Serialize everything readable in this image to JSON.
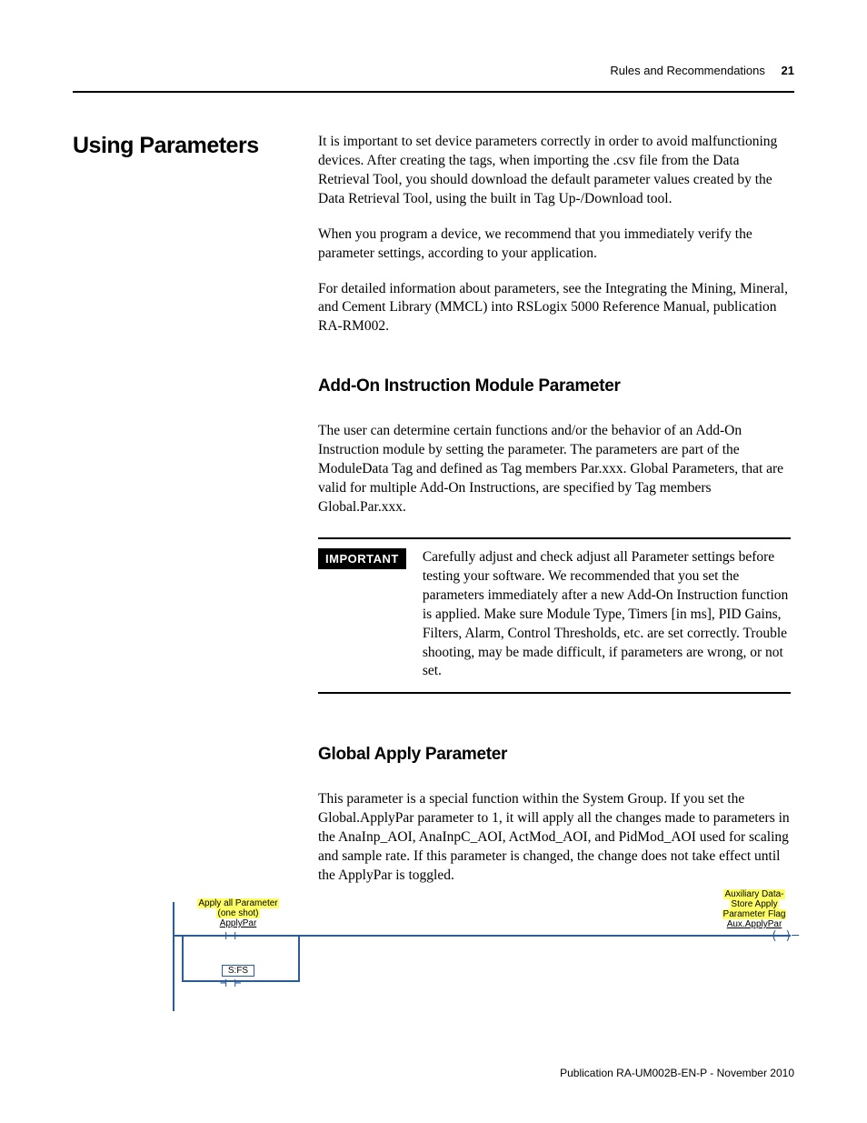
{
  "header": {
    "section": "Rules and Recommendations",
    "page_number": "21"
  },
  "main": {
    "title": "Using Parameters",
    "paragraphs": {
      "p1": "It is important to set device parameters correctly in order to avoid malfunctioning devices. After creating the tags, when importing the .csv file from the Data Retrieval Tool, you should download the default parameter values created by the Data Retrieval Tool, using the built in Tag Up-/Download tool.",
      "p2": "When you program a device, we recommend that you immediately verify the parameter settings, according to your application.",
      "p3": "For detailed information about parameters, see the Integrating the Mining, Mineral, and Cement Library (MMCL) into RSLogix 5000 Reference Manual, publication RA-RM002."
    },
    "sub1": {
      "heading": "Add-On Instruction Module Parameter",
      "p1": "The user can determine certain functions and/or the behavior of an Add-On Instruction module by setting the parameter. The parameters are part of the ModuleData Tag and defined as Tag members Par.xxx. Global Parameters, that are valid for multiple Add-On Instructions, are specified by Tag members Global.Par.xxx."
    },
    "callout": {
      "label": "IMPORTANT",
      "body": "Carefully adjust and check adjust all Parameter settings before testing your software. We recommended that you set the parameters immediately after a new Add-On Instruction function is applied. Make sure Module Type, Timers [in ms], PID Gains, Filters, Alarm, Control Thresholds, etc. are set correctly. Trouble shooting, may be made difficult, if parameters are wrong, or not set."
    },
    "sub2": {
      "heading": "Global Apply Parameter",
      "p1": "This parameter is a special function within the System Group. If you set the Global.ApplyPar parameter to 1, it will apply all the changes made to parameters in the AnaInp_AOI, AnaInpC_AOI, ActMod_AOI, and PidMod_AOI used for scaling and sample rate. If this parameter is changed, the change does not take effect until the ApplyPar is toggled."
    }
  },
  "diagram": {
    "left_comment_l1": "Apply all Parameter",
    "left_comment_l2": "(one shot)",
    "left_tag": "ApplyPar",
    "sfs": "S:FS",
    "right_comment_l1": "Auxiliary Data-",
    "right_comment_l2": "Store Apply",
    "right_comment_l3": "Parameter Flag",
    "right_tag": "Aux.ApplyPar"
  },
  "footer": {
    "text": "Publication RA-UM002B-EN-P - November 2010"
  }
}
